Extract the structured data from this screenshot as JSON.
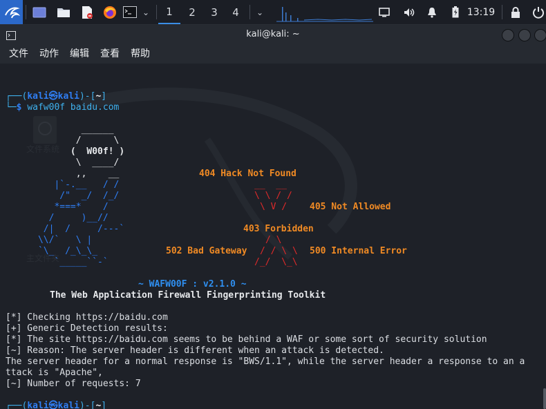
{
  "taskbar": {
    "workspaces": [
      "1",
      "2",
      "3",
      "4"
    ],
    "active_workspace": "1",
    "clock": "13:19",
    "colors": {
      "accent": "#3a8ee6"
    }
  },
  "window": {
    "title": "kali@kali: ~",
    "menu": [
      "文件",
      "动作",
      "编辑",
      "查看",
      "帮助"
    ]
  },
  "desktop_icons": [
    "文件系统",
    "主文件夹"
  ],
  "terminal": {
    "prompt": {
      "user": "kali",
      "host": "kali",
      "dir": "~"
    },
    "command": "wafw00f baidu.com",
    "banner": {
      "ascii_woof": [
        "              ______",
        "             /      \\",
        "            (  W00f! )",
        "             \\  ____/",
        "             ,,    __",
        "         |`-.__   / /",
        "          /\"  _/  /_/",
        "         *===*    /",
        "        /     )__//",
        "       /|  /     /---`",
        "      \\\\/`   \\ |",
        "      `\\_  /_\\_\\_",
        "         `_____``-`"
      ],
      "errors": {
        "e404": "404 Hack Not Found",
        "e405": "405 Not Allowed",
        "e403": "403 Forbidden",
        "e502": "502 Bad Gateway",
        "e500": "500 Internal Error"
      },
      "red_x": [
        "__  __",
        "\\ \\ / /",
        "\\ V /",
        "/ \\",
        "/ / \\ \\",
        "/_/  \\_\\"
      ],
      "version": "~ WAFW00F : v2.1.0 ~",
      "subtitle": "The Web Application Firewall Fingerprinting Toolkit"
    },
    "output": [
      "[*] Checking https://baidu.com",
      "[+] Generic Detection results:",
      "[*] The site https://baidu.com seems to be behind a WAF or some sort of security solution",
      "[~] Reason: The server header is different when an attack is detected.",
      "The server header for a normal response is \"BWS/1.1\", while the server header a response to an a",
      "ttack is \"Apache\",",
      "[~] Number of requests: 7"
    ]
  }
}
